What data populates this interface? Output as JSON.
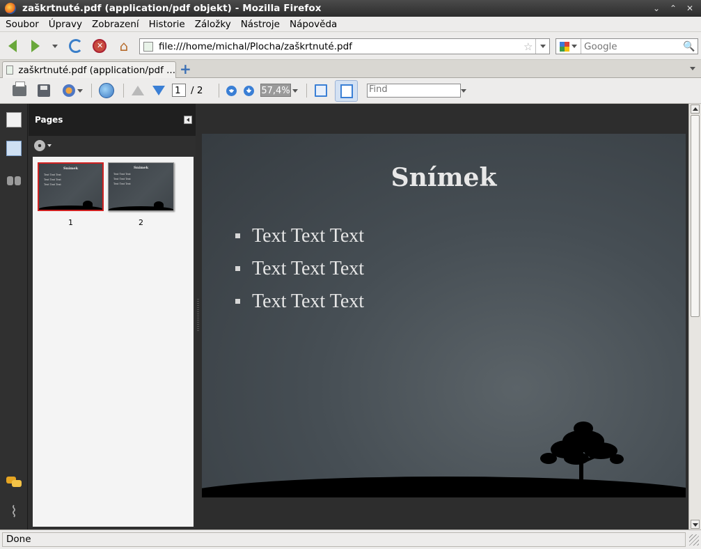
{
  "window": {
    "title": "zaškrtnuté.pdf (application/pdf objekt) - Mozilla Firefox",
    "controls": [
      "⌄",
      "⌃",
      "✕"
    ]
  },
  "menu": [
    "Soubor",
    "Úpravy",
    "Zobrazení",
    "Historie",
    "Záložky",
    "Nástroje",
    "Nápověda"
  ],
  "nav": {
    "url": "file:///home/michal/Plocha/zaškrtnuté.pdf",
    "search_placeholder": "Google"
  },
  "tabs": [
    {
      "label": "zaškrtnuté.pdf (application/pdf ..."
    }
  ],
  "pdf_toolbar": {
    "current_page": "1",
    "page_total": "/  2",
    "zoom": "57,4%",
    "find_placeholder": "Find"
  },
  "sidebar": {
    "panel_title": "Pages",
    "thumbnails": [
      {
        "number": "1",
        "selected": true,
        "title": "Snímek",
        "lines": [
          "Text Text Text",
          "Text Text Text",
          "Text Text Text"
        ]
      },
      {
        "number": "2",
        "selected": false,
        "title": "Snímek",
        "lines": [
          "Text Text Text",
          "Text Text Text",
          "Text Text Text"
        ]
      }
    ]
  },
  "slide": {
    "title": "Snímek",
    "bullets": [
      "Text Text Text",
      "Text Text Text",
      "Text Text Text"
    ]
  },
  "status": "Done",
  "colors": {
    "selected_thumb_border": "#d12121",
    "slide_bg": "#464e54",
    "viewer_bg": "#2d2d2d"
  }
}
